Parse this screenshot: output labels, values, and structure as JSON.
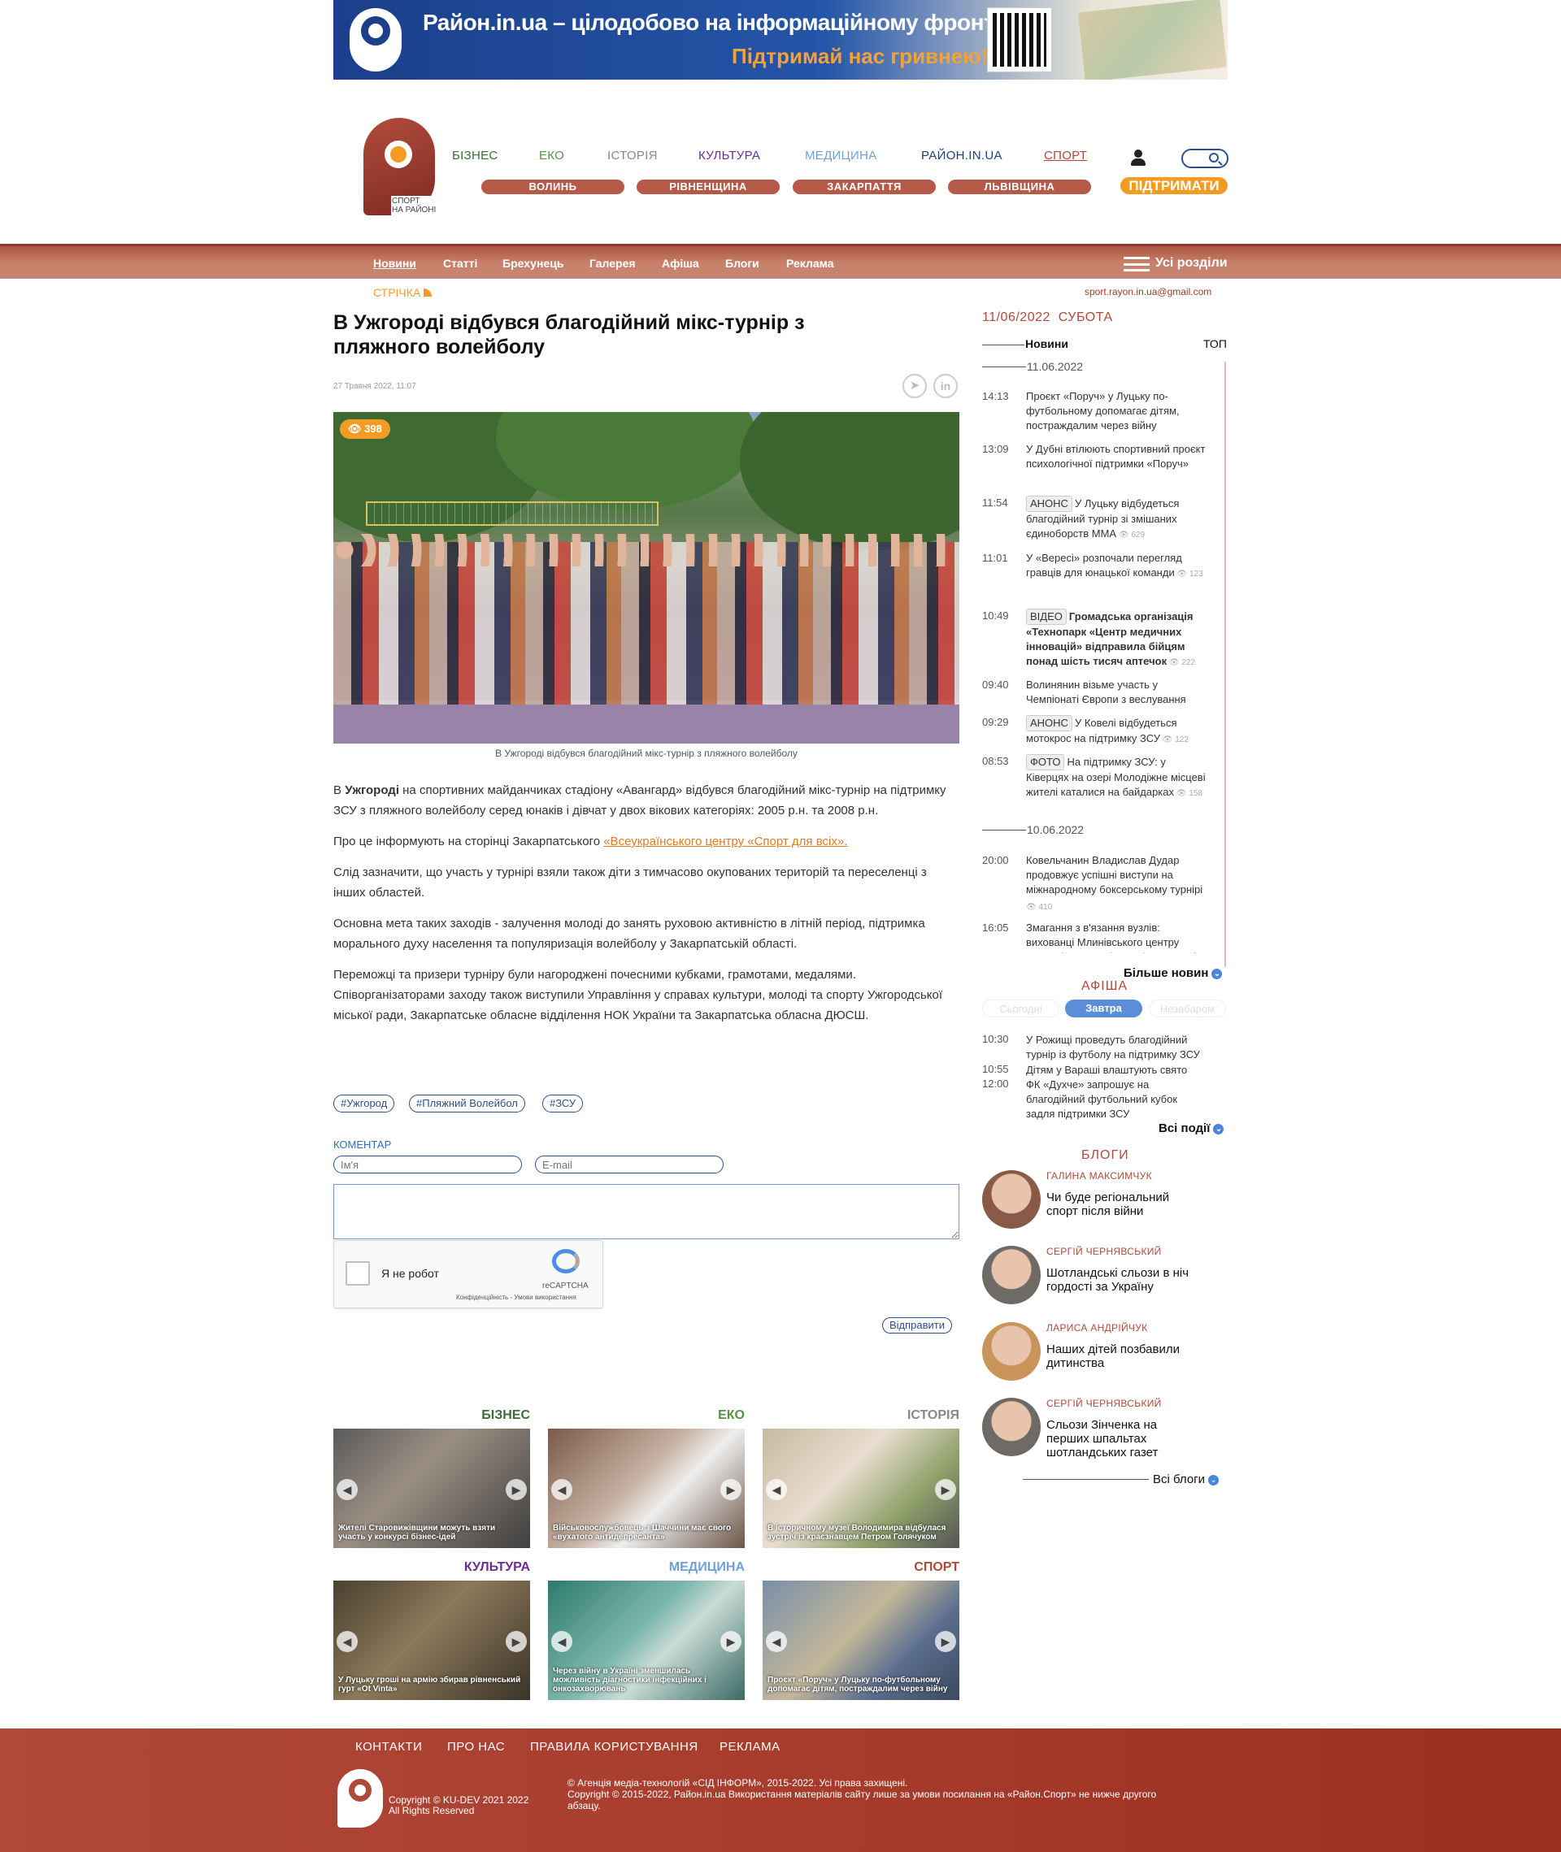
{
  "banner": {
    "title": "Район.in.ua – цілодобово на інформаційному фронті.",
    "subtitle": "Підтримай нас гривнею!"
  },
  "logo": {
    "caption_line1": "СПОРТ",
    "caption_line2": "НА РАЙОНІ"
  },
  "topnav": [
    {
      "label": "БІЗНЕС",
      "color": "#3c6b3a"
    },
    {
      "label": "ЕКО",
      "color": "#5a8f4a"
    },
    {
      "label": "ІСТОРІЯ",
      "color": "#888888"
    },
    {
      "label": "КУЛЬТУРА",
      "color": "#6b2c91"
    },
    {
      "label": "МЕДИЦИНА",
      "color": "#6fa0d8"
    },
    {
      "label": "РАЙОН.IN.UA",
      "color": "#1f3f7a"
    },
    {
      "label": "СПОРТ",
      "color": "#b0493a"
    }
  ],
  "regions": [
    "ВОЛИНЬ",
    "РІВНЕНЩИНА",
    "ЗАКАРПАТТЯ",
    "ЛЬВІВЩИНА"
  ],
  "support_label": "ПІДТРИМАТИ",
  "menu": [
    "Новини",
    "Статті",
    "Брехунець",
    "Галерея",
    "Афіша",
    "Блоги",
    "Реклама"
  ],
  "all_sections": "Усі розділи",
  "feed_label": "СТРІЧКА",
  "contact_email": "sport.rayon.in.ua@gmail.com",
  "article": {
    "title": "В Ужгороді відбувся благодійний мікс-турнір з пляжного волейболу",
    "date": "27 Травня 2022, 11:07",
    "views": "398",
    "caption": "В Ужгороді відбувся благодійний мікс-турнір з пляжного волейболу",
    "p1_prefix": "В ",
    "p1_bold": "Ужгороді",
    "p1_rest": " на спортивних майданчиках стадіону «Авангард» відбувся благодійний мікс-турнір на підтримку ЗСУ з пляжного волейболу серед юнаків і дівчат у двох вікових категоріях: 2005 р.н. та 2008 р.н.",
    "p2_prefix": "Про це інформують на сторінці Закарпатського ",
    "p2_link": "«Всеукраїнського центру «Спорт для всіх».",
    "p3": "Слід зазначити, що участь у турнірі взяли також діти з тимчасово окупованих територій та переселенці з інших областей.",
    "p4": "Основна мета таких заходів - залучення молоді до занять руховою активністю в літній період, підтримка морального духу населення та популяризація волейболу у Закарпатській області.",
    "p5": "Переможці та призери турніру були нагороджені почесними кубками, грамотами, медалями. Співорганізаторами заходу також виступили Управління у справах культури, молоді та спорту Ужгородської міської ради, Закарпатське обласне відділення НОК України та Закарпатська обласна ДЮСШ.",
    "tags": [
      "#Ужгород",
      "#Пляжний Волейбол",
      "#ЗСУ"
    ]
  },
  "comment": {
    "label": "КОМЕНТАР",
    "name_placeholder": "Ім'я",
    "email_placeholder": "E-mail",
    "captcha_label": "Я не робот",
    "captcha_brand": "reCAPTCHA",
    "captcha_terms": "Конфіденційність - Умови використання",
    "send_label": "Відправити"
  },
  "categories": [
    {
      "title": "БІЗНЕС",
      "color": "#3c6b3a",
      "text": "Жителі Старовижівщини можуть взяти участь у конкурсі бізнес-ідей",
      "bg": "linear-gradient(135deg,#5a5a5a,#9b8f83 40%,#3f3f3f)"
    },
    {
      "title": "ЕКО",
      "color": "#5a8f4a",
      "text": "Військовослужбовець з Шаччини має свого «вухатого антидепресанта»",
      "bg": "linear-gradient(135deg,#7a5a4a,#c9b3a4 45%,#eee 60%,#6b5546)"
    },
    {
      "title": "ІСТОРІЯ",
      "color": "#888888",
      "text": "В історичному музеї Володимира відбулася зустріч із краєзнавцем Петром Голячуком",
      "bg": "linear-gradient(135deg,#c7b9a0,#e8ddd0 40%,#8fa06a 70%,#555)"
    },
    {
      "title": "КУЛЬТУРА",
      "color": "#6b2c91",
      "text": "У Луцьку гроші на армію збирав рівненський гурт «Ot Vinta»",
      "bg": "linear-gradient(135deg,#4a4030,#8c7a5a 45%,#3a3328)"
    },
    {
      "title": "МЕДИЦИНА",
      "color": "#6fa0d8",
      "text": "Через війну в Україні зменшилась можливість діагностики інфекційних і онкозахворювань",
      "bg": "linear-gradient(135deg,#2d7a6e,#7fb8ad 45%,#c9dcd6 60%,#3a6a63)"
    },
    {
      "title": "СПОРТ",
      "color": "#b0493a",
      "text": "Проєкт «Поруч» у Луцьку по-футбольному допомагає дітям, постраждалим через війну",
      "bg": "linear-gradient(135deg,#7a8fa8,#c4b79a 45%,#5a6e8f 70%,#3d4a5e)"
    }
  ],
  "sidebar": {
    "date": "11/06/2022",
    "weekday": "СУБОТА",
    "tab_news": "Новини",
    "tab_top": "ТОП",
    "day1": "11.06.2022",
    "day2": "10.06.2022",
    "news": [
      {
        "time": "14:13",
        "badge": "",
        "text": "Проєкт «Поруч» у Луцьку по-футбольному допомагає дітям, постраждалим через війну",
        "bold": false,
        "views": ""
      },
      {
        "time": "13:09",
        "badge": "",
        "text": "У Дубні втілюють спортивний проєкт психологічної підтримки «Поруч»",
        "bold": false,
        "views": ""
      },
      {
        "time": "11:54",
        "badge": "АНОНС",
        "text": "У Луцьку відбудеться благодійний турнір зі змішаних єдиноборств ММА",
        "bold": false,
        "views": "629"
      },
      {
        "time": "11:01",
        "badge": "",
        "text": "У «Вересі» розпочали перегляд гравців для юнацької команди",
        "bold": false,
        "views": "123"
      },
      {
        "time": "10:49",
        "badge": "ВІДЕО",
        "text": "Громадська організація «Технопарк «Центр медичних інновацій» відправила бійцям понад шість тисяч аптечок",
        "bold": true,
        "views": "222"
      },
      {
        "time": "09:40",
        "badge": "",
        "text": "Волинянин візьме участь у Чемпіонаті Європи з веслування",
        "bold": false,
        "views": ""
      },
      {
        "time": "09:29",
        "badge": "АНОНС",
        "text": "У Ковелі відбудеться мотокрос на підтримку ЗСУ",
        "bold": false,
        "views": "122"
      },
      {
        "time": "08:53",
        "badge": "ФОТО",
        "text": "На підтримку ЗСУ: у Ківерцях на озері Молодіжне місцеві жителі каталися на байдарках",
        "bold": false,
        "views": "158"
      },
      {
        "time": "20:00",
        "badge": "",
        "text": "Ковельчанин Владислав Дудар продовжує успішні виступи на міжнародному боксерському турнірі",
        "bold": false,
        "views": "410"
      },
      {
        "time": "16:05",
        "badge": "",
        "text": "Змагання з в'язання вузлів: вихованці Млинівського центру позашкільної освіти посіли призові",
        "bold": false,
        "views": ""
      }
    ],
    "more_news": "Більше новин",
    "afisha_title": "АФІША",
    "afisha_tabs": [
      "Сьогодні",
      "Завтра",
      "Незабаром"
    ],
    "events": [
      {
        "time": "10:30",
        "text": "У Рожищі проведуть благодійний турнір із футболу на підтримку ЗСУ"
      },
      {
        "time": "10:55",
        "text": "Дітям у Вараші влаштують свято"
      },
      {
        "time": "12:00",
        "text": "ФК «Духче» запрошує на благодійний футбольний кубок задля підтримки ЗСУ"
      }
    ],
    "all_events": "Всі події",
    "blogs_title": "БЛОГИ",
    "blogs": [
      {
        "author": "ГАЛИНА МАКСИМЧУК",
        "title": "Чи буде регіональний спорт після війни",
        "face": "#8a5a48"
      },
      {
        "author": "СЕРГІЙ ЧЕРНЯВСЬКИЙ",
        "title": "Шотландські сльози в ніч гордості за Україну",
        "face": "#6e6a66"
      },
      {
        "author": "ЛАРИСА АНДРІЙЧУК",
        "title": "Наших дітей позбавили дитинства",
        "face": "#c9945a"
      },
      {
        "author": "СЕРГІЙ ЧЕРНЯВСЬКИЙ",
        "title": "Сльози Зінченка на перших шпальтах шотландських газет",
        "face": "#6e6a66"
      }
    ],
    "all_blogs": "Всі блоги"
  },
  "footer": {
    "links": [
      "КОНТАКТИ",
      "ПРО НАС",
      "ПРАВИЛА КОРИСТУВАННЯ",
      "РЕКЛАМА"
    ],
    "copy_left_1": "Copyright © KU-DEV 2021 2022",
    "copy_left_2": "All Rights Reserved",
    "copy_right_1": "© Агенція медіа-технологій «СІД ІНФОРМ», 2015-2022. Усі права захищені.",
    "copy_right_2": "Copyright © 2015-2022, Район.in.ua Використання матеріалів сайту лише за умови посилання на «Район.Спорт» не нижче другого абзацу."
  }
}
